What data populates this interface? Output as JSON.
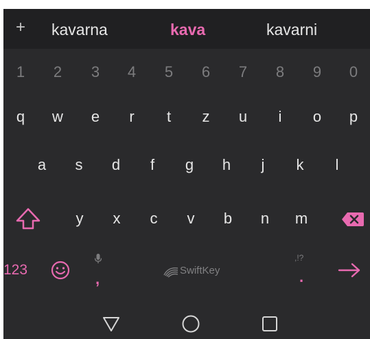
{
  "suggestions": {
    "add_icon": "plus-icon",
    "plus_label": "+",
    "left": "kavarna",
    "center": "kava",
    "right": "kavarni"
  },
  "number_row": [
    "1",
    "2",
    "3",
    "4",
    "5",
    "6",
    "7",
    "8",
    "9",
    "0"
  ],
  "row_1": [
    "q",
    "w",
    "e",
    "r",
    "t",
    "z",
    "u",
    "i",
    "o",
    "p"
  ],
  "row_2": [
    "a",
    "s",
    "d",
    "f",
    "g",
    "h",
    "j",
    "k",
    "l"
  ],
  "row_3": [
    "y",
    "x",
    "c",
    "v",
    "b",
    "n",
    "m"
  ],
  "bottom_row": {
    "numbers_label": "123",
    "comma": ",",
    "comma_hint_icon": "microphone-icon",
    "period": ".",
    "period_hint": ",!?",
    "brand": "SwiftKey"
  },
  "icons": {
    "shift": "shift-icon",
    "backspace": "backspace-icon",
    "emoji": "emoji-icon",
    "enter": "enter-arrow-icon",
    "back": "nav-back-icon",
    "home": "nav-home-icon",
    "recents": "nav-recents-icon"
  },
  "colors": {
    "accent": "#e86ab0",
    "keyboard_bg": "#2a2a2c",
    "suggestion_bg": "#202022",
    "key_text": "#e6e6e6",
    "number_text": "#7c7c7e"
  }
}
